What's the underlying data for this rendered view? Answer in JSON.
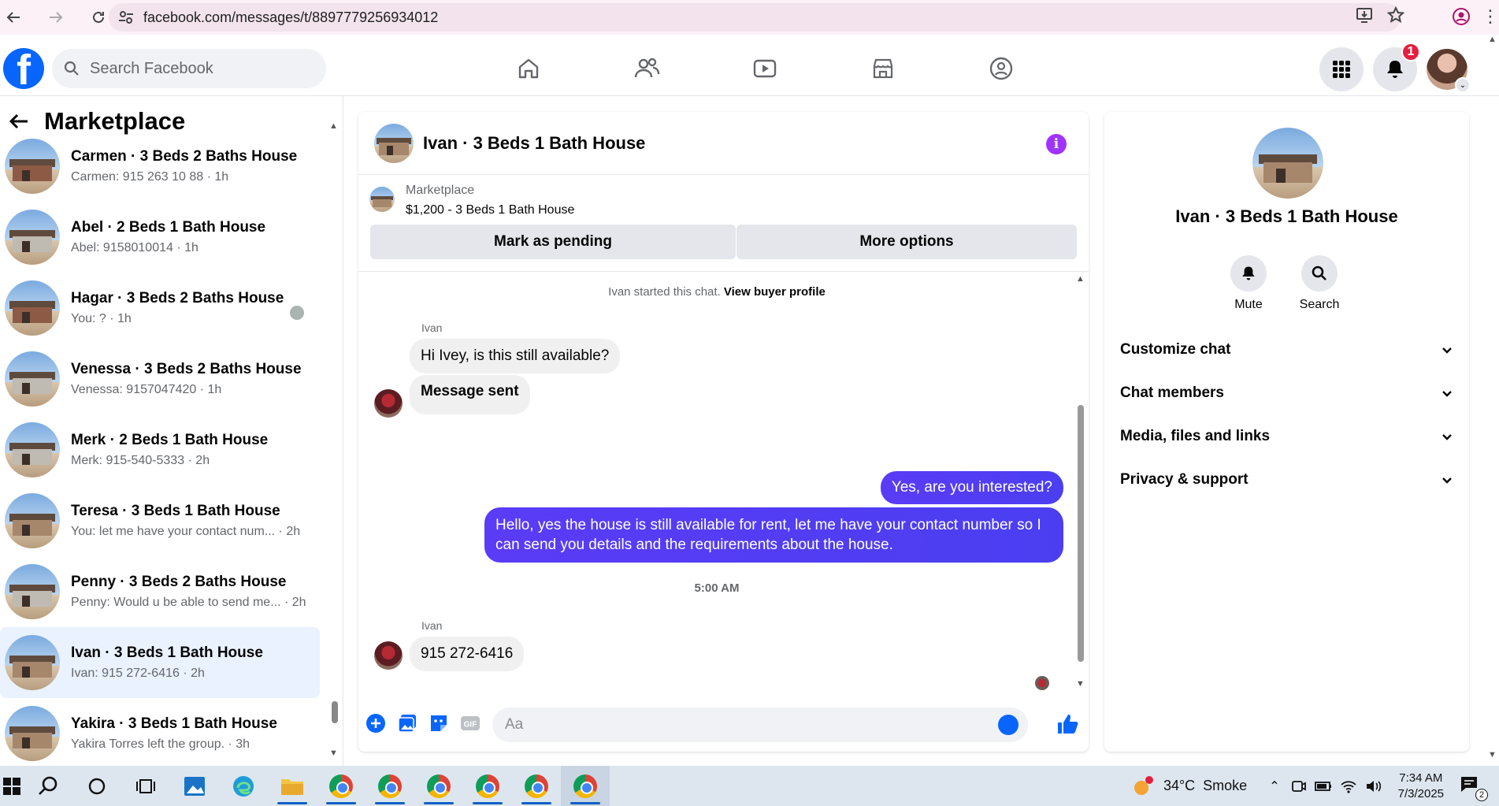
{
  "browser": {
    "url": "facebook.com/messages/t/8897779256934012"
  },
  "header": {
    "search_placeholder": "Search Facebook",
    "notifications_count": "1"
  },
  "sidebar": {
    "title": "Marketplace",
    "conversations": [
      {
        "name": "Carmen · 3 Beds 2 Baths House",
        "preview": "Carmen: 915 263 10 88 · 1h",
        "style": "brick"
      },
      {
        "name": "Abel · 2 Beds 1 Bath House",
        "preview": "Abel: 9158010014 · 1h",
        "style": "gray"
      },
      {
        "name": "Hagar · 3 Beds 2 Baths House",
        "preview": "You: ? · 1h",
        "style": "brick"
      },
      {
        "name": "Venessa · 3 Beds 2 Baths House",
        "preview": "Venessa: 9157047420 · 1h",
        "style": "gray"
      },
      {
        "name": "Merk · 2 Beds 1 Bath House",
        "preview": "Merk: 915-540-5333 · 2h",
        "style": "gray"
      },
      {
        "name": "Teresa · 3 Beds 1 Bath House",
        "preview": "You: let me have your contact num... · 2h",
        "style": "tan"
      },
      {
        "name": "Penny · 3 Beds 2 Baths House",
        "preview": "Penny: Would u be able to send me... · 2h",
        "style": "gray"
      },
      {
        "name": "Ivan · 3 Beds 1 Bath House",
        "preview": "Ivan: 915 272-6416 · 2h",
        "style": "tan"
      },
      {
        "name": "Yakira · 3 Beds 1 Bath House",
        "preview": "Yakira Torres left the group. · 3h",
        "style": "tan"
      }
    ]
  },
  "chat": {
    "title": "Ivan · 3 Beds 1 Bath House",
    "marketplace_label": "Marketplace",
    "listing": "$1,200 - 3 Beds 1 Bath House",
    "mark_pending": "Mark as pending",
    "more_options": "More options",
    "system_prefix": "Ivan started this chat.",
    "system_link": "View buyer profile",
    "sender_name": "Ivan",
    "msg_in_1": "Hi Ivey, is this still available?",
    "msg_in_2": "Message sent",
    "msg_out_1": "Yes, are you interested?",
    "msg_out_2": "Hello, yes the house is still available for rent, let me have your contact number so I can send you details and the requirements about the house.",
    "time_sep": "5:00 AM",
    "msg_in_3": "915 272-6416",
    "composer_placeholder": "Aa"
  },
  "details": {
    "name": "Ivan · 3 Beds 1 Bath House",
    "mute": "Mute",
    "search": "Search",
    "sections": [
      "Customize chat",
      "Chat members",
      "Media, files and links",
      "Privacy & support"
    ]
  },
  "taskbar": {
    "temperature": "34°C",
    "weather": "Smoke",
    "time": "7:34 AM",
    "date": "7/3/2025",
    "notif_count": "2"
  }
}
